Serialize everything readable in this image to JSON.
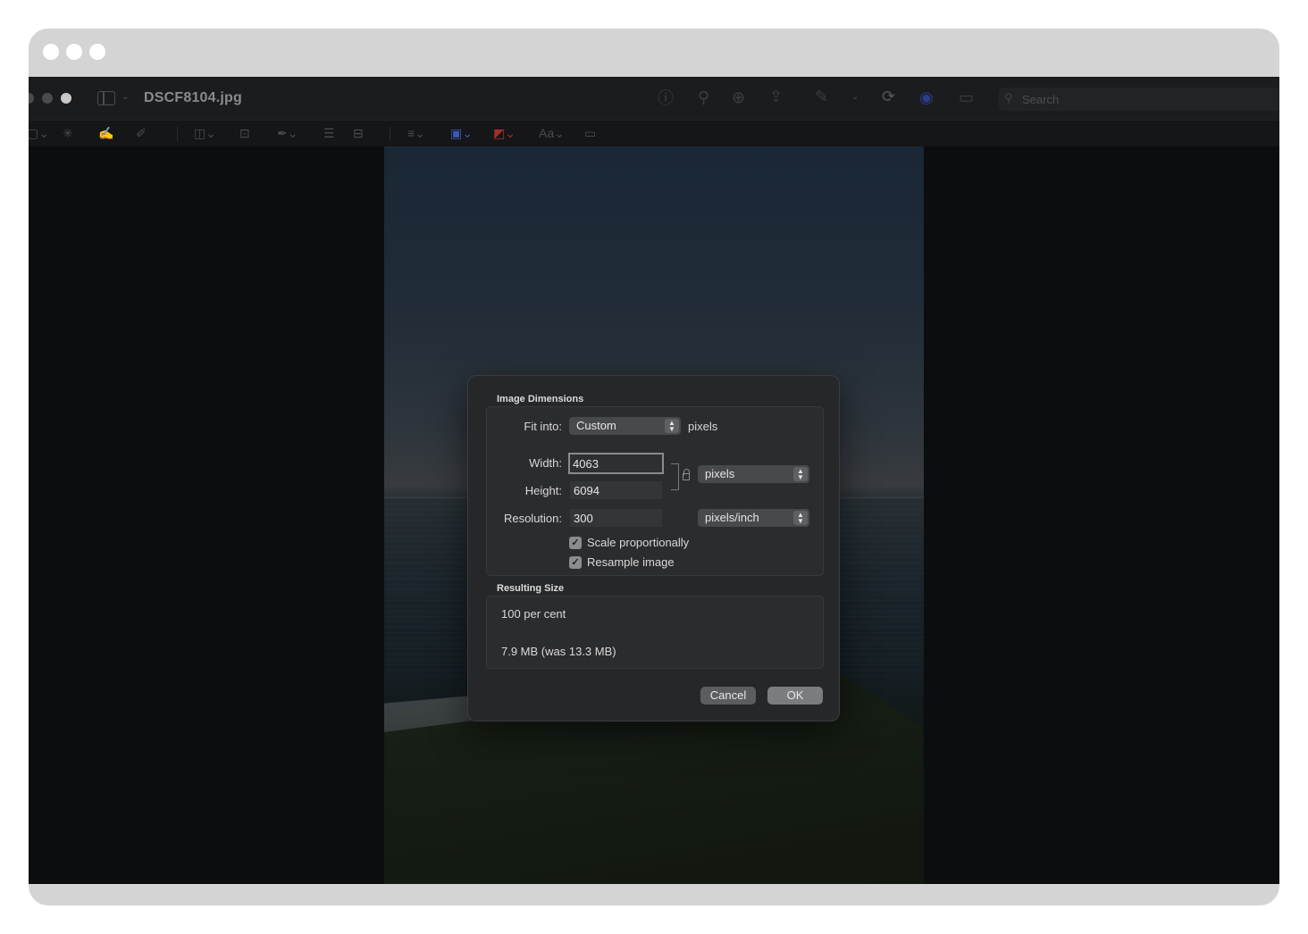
{
  "window": {
    "document_title": "DSCF8104.jpg",
    "search_placeholder": "Search"
  },
  "toolbar_icons": [
    "info-icon",
    "zoom-out-icon",
    "zoom-in-icon",
    "share-icon",
    "markup-pen-icon",
    "rotate-icon",
    "markup-icon",
    "highlight-icon",
    "search-icon"
  ],
  "markup_icons": [
    "selection-icon",
    "instant-alpha-icon",
    "sketch-icon",
    "draw-icon",
    "shapes-icon",
    "text-icon",
    "sign-icon",
    "adjust-color-icon",
    "adjust-size-icon",
    "shape-style-icon",
    "border-color-icon",
    "fill-color-icon",
    "text-style-icon",
    "note-icon"
  ],
  "dialog": {
    "dimensions_heading": "Image Dimensions",
    "fit_into_label": "Fit into:",
    "fit_into_value": "Custom",
    "fit_into_unit": "pixels",
    "width_label": "Width:",
    "width_value": "4063",
    "height_label": "Height:",
    "height_value": "6094",
    "resolution_label": "Resolution:",
    "resolution_value": "300",
    "size_unit": "pixels",
    "resolution_unit": "pixels/inch",
    "scale_proportionally_label": "Scale proportionally",
    "scale_proportionally_checked": true,
    "resample_label": "Resample image",
    "resample_checked": true,
    "resulting_heading": "Resulting Size",
    "result_percent": "100 per cent",
    "result_size": "7.9 MB (was 13.3 MB)",
    "cancel_label": "Cancel",
    "ok_label": "OK"
  },
  "colors": {
    "window_bg": "#0e0f11",
    "dialog_bg": "#262729",
    "group_bg": "#2b2c2e"
  }
}
